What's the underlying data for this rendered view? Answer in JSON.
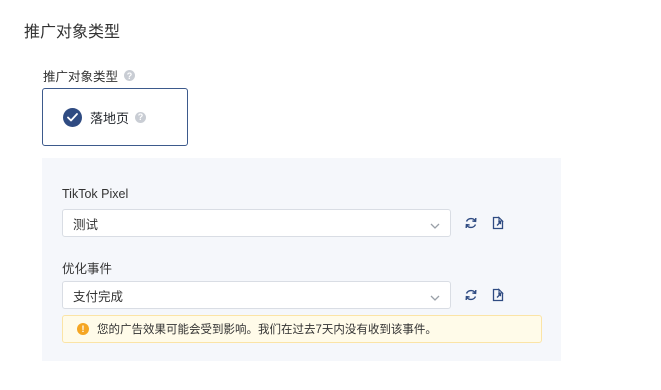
{
  "section": {
    "title": "推广对象类型"
  },
  "promotion_type": {
    "label": "推广对象类型",
    "help_icon": "question-icon",
    "option": {
      "label": "落地页",
      "selected": true
    }
  },
  "pixel": {
    "label": "TikTok Pixel",
    "selected_value": "测试",
    "refresh_icon": "refresh-icon",
    "open_icon": "open-in-new-icon"
  },
  "event": {
    "label": "优化事件",
    "selected_value": "支付完成",
    "refresh_icon": "refresh-icon",
    "open_icon": "open-in-new-icon"
  },
  "warning": {
    "text": "您的广告效果可能会受到影响。我们在过去7天内没有收到该事件。",
    "icon": "warning-icon"
  },
  "colors": {
    "primary": "#2f4b82",
    "panel_bg": "#f5f7fb",
    "warning_bg": "#fffbe9",
    "warning_icon": "#f5a623"
  }
}
